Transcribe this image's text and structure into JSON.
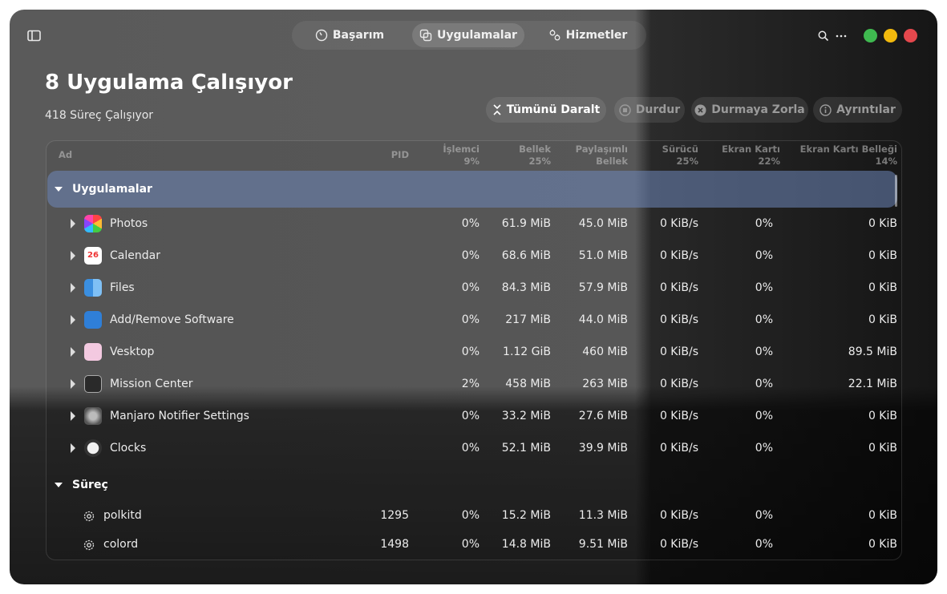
{
  "header": {
    "sidebar_icon": "sidebar-toggle-icon",
    "tabs": [
      {
        "label": "Başarım",
        "icon": "gauge-icon"
      },
      {
        "label": "Uygulamalar",
        "icon": "apps-icon"
      },
      {
        "label": "Hizmetler",
        "icon": "services-gear-icon"
      }
    ],
    "window_controls": {
      "green": "#3fb950",
      "yellow": "#f2b90d",
      "red": "#e5484d"
    }
  },
  "summary": {
    "title": "8 Uygulama Çalışıyor",
    "subtitle": "418 Süreç Çalışıyor"
  },
  "actions": {
    "collapse_all": "Tümünü Daralt",
    "stop": "Durdur",
    "force_stop": "Durmaya Zorla",
    "details": "Ayrıntılar"
  },
  "table": {
    "columns": {
      "name": "Ad",
      "pid": "PID",
      "cpu": "İşlemci",
      "cpu_pct": "9%",
      "mem": "Bellek",
      "mem_pct": "25%",
      "shared1": "Paylaşımlı",
      "shared2": "Bellek",
      "drive": "Sürücü",
      "drive_pct": "25%",
      "gpu": "Ekran Kartı",
      "gpu_pct": "22%",
      "gpumem": "Ekran Kartı Belleği",
      "gpumem_pct": "14%"
    },
    "apps_group": "Uygulamalar",
    "apps": [
      {
        "name": "Photos",
        "pid": "",
        "cpu": "0%",
        "mem": "61.9 MiB",
        "shared": "45.0 MiB",
        "drive": "0 KiB/s",
        "gpu": "0%",
        "gpumem": "0 KiB"
      },
      {
        "name": "Calendar",
        "pid": "",
        "cpu": "0%",
        "mem": "68.6 MiB",
        "shared": "51.0 MiB",
        "drive": "0 KiB/s",
        "gpu": "0%",
        "gpumem": "0 KiB",
        "icon_text": "26"
      },
      {
        "name": "Files",
        "pid": "",
        "cpu": "0%",
        "mem": "84.3 MiB",
        "shared": "57.9 MiB",
        "drive": "0 KiB/s",
        "gpu": "0%",
        "gpumem": "0 KiB"
      },
      {
        "name": "Add/Remove Software",
        "pid": "",
        "cpu": "0%",
        "mem": "217 MiB",
        "shared": "44.0 MiB",
        "drive": "0 KiB/s",
        "gpu": "0%",
        "gpumem": "0 KiB"
      },
      {
        "name": "Vesktop",
        "pid": "",
        "cpu": "0%",
        "mem": "1.12 GiB",
        "shared": "460 MiB",
        "drive": "0 KiB/s",
        "gpu": "0%",
        "gpumem": "89.5 MiB"
      },
      {
        "name": "Mission Center",
        "pid": "",
        "cpu": "2%",
        "mem": "458 MiB",
        "shared": "263 MiB",
        "drive": "0 KiB/s",
        "gpu": "0%",
        "gpumem": "22.1 MiB"
      },
      {
        "name": "Manjaro Notifier Settings",
        "pid": "",
        "cpu": "0%",
        "mem": "33.2 MiB",
        "shared": "27.6 MiB",
        "drive": "0 KiB/s",
        "gpu": "0%",
        "gpumem": "0 KiB"
      },
      {
        "name": "Clocks",
        "pid": "",
        "cpu": "0%",
        "mem": "52.1 MiB",
        "shared": "39.9 MiB",
        "drive": "0 KiB/s",
        "gpu": "0%",
        "gpumem": "0 KiB"
      }
    ],
    "process_group": "Süreç",
    "processes": [
      {
        "name": "polkitd",
        "pid": "1295",
        "cpu": "0%",
        "mem": "15.2 MiB",
        "shared": "11.3 MiB",
        "drive": "0 KiB/s",
        "gpu": "0%",
        "gpumem": "0 KiB"
      },
      {
        "name": "colord",
        "pid": "1498",
        "cpu": "0%",
        "mem": "14.8 MiB",
        "shared": "9.51 MiB",
        "drive": "0 KiB/s",
        "gpu": "0%",
        "gpumem": "0 KiB"
      }
    ]
  }
}
